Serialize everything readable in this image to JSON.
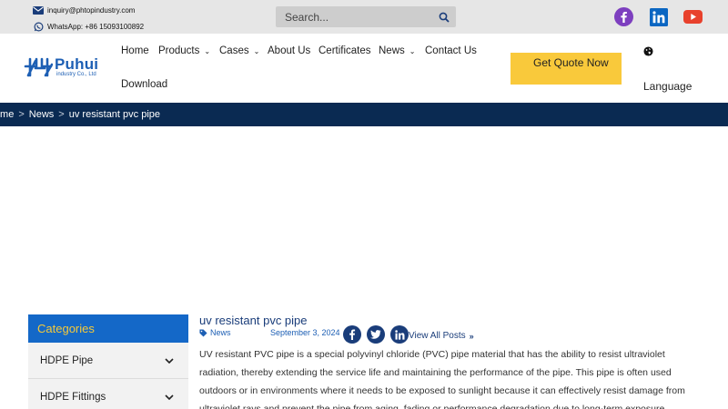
{
  "topbar": {
    "email": "inquiry@phtopindustry.com",
    "phone": "WhatsApp: +86 15093100892",
    "search_placeholder": "Search..."
  },
  "icons": {
    "email": "envelope-icon",
    "phone": "whatsapp-icon",
    "search": "search-icon",
    "facebook": "facebook-icon",
    "linkedin": "linkedin-icon",
    "youtube": "youtube-icon",
    "language": "globe-icon"
  },
  "colors": {
    "topbar_bg": "#e6e6e6",
    "brand_blue": "#1d5fb4",
    "navy": "#0a2a52",
    "cta_yellow": "#f9c93b",
    "category_header": "#1468c8",
    "category_text": "#f5c93a",
    "facebook": "#3b5998",
    "linkedin": "#0a66c2",
    "youtube": "#e8412c"
  },
  "logo": {
    "name": "Puhui",
    "subtitle": "industry Co., Ltd"
  },
  "nav": {
    "home": "Home",
    "products": "Products",
    "cases": "Cases",
    "about": "About Us",
    "certificates": "Certificates",
    "news": "News",
    "contact": "Contact Us",
    "download": "Download",
    "cta": "Get Quote Now",
    "language": "Language"
  },
  "breadcrumb": {
    "home": "Home",
    "news": "News",
    "current": "uv resistant pvc pipe",
    "separator": ">"
  },
  "sidebar": {
    "heading": "Categories",
    "items": [
      {
        "label": "HDPE Pipe"
      },
      {
        "label": "HDPE Fittings"
      }
    ]
  },
  "article": {
    "title": "uv resistant pvc pipe",
    "category": "News",
    "date": "September 3, 2024",
    "view_all": "View All Posts",
    "body": "UV resistant PVC pipe is a special polyvinyl chloride (PVC) pipe material that has the ability to resist ultraviolet radiation, thereby extending the service life and maintaining the performance of the pipe. This pipe is often used outdoors or in environments where it needs to be exposed to sunlight because it can effectively resist damage from ultraviolet rays and prevent the pipe from aging, fading or performance degradation due to long-term exposure."
  }
}
